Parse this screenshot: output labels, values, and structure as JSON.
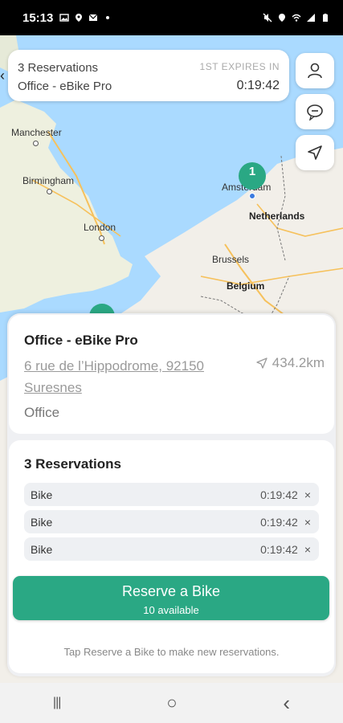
{
  "status_bar": {
    "time": "15:13",
    "left_icons": [
      "image-icon",
      "location-pin-icon",
      "mail-icon",
      "dot-icon"
    ],
    "right_icons": [
      "mute-icon",
      "location-icon",
      "wifi-icon",
      "signal-icon",
      "battery-icon"
    ]
  },
  "map": {
    "labels": {
      "manchester": "Manchester",
      "birmingham": "Birmingham",
      "london": "London",
      "amsterdam": "Amsterdam",
      "netherlands": "Netherlands",
      "brussels": "Brussels",
      "belgium": "Belgium"
    },
    "marker_count": "1",
    "colors": {
      "water": "#aadaff",
      "land": "#f2efe9",
      "marker": "#2aa884"
    }
  },
  "top_card": {
    "reservations": "3 Reservations",
    "location": "Office - eBike Pro",
    "expires_label": "1ST EXPIRES IN",
    "expires_time": "0:19:42"
  },
  "side_buttons": [
    "profile-icon",
    "chat-icon",
    "navigate-icon"
  ],
  "location_card": {
    "title": "Office - eBike Pro",
    "address": "6 rue de l’Hippodrome, 92150 Suresnes",
    "distance": "434.2km",
    "type": "Office"
  },
  "reservations_card": {
    "title": "3 Reservations",
    "items": [
      {
        "label": "Bike",
        "time": "0:19:42",
        "remove": "×"
      },
      {
        "label": "Bike",
        "time": "0:19:42",
        "remove": "×"
      },
      {
        "label": "Bike",
        "time": "0:19:42",
        "remove": "×"
      }
    ]
  },
  "reserve_button": {
    "label": "Reserve a Bike",
    "available": "10 available",
    "color": "#2aa884"
  },
  "hint": "Tap Reserve a Bike to make new reservations.",
  "nav_bar": {
    "recents": "|||",
    "home": "○",
    "back": "‹"
  }
}
